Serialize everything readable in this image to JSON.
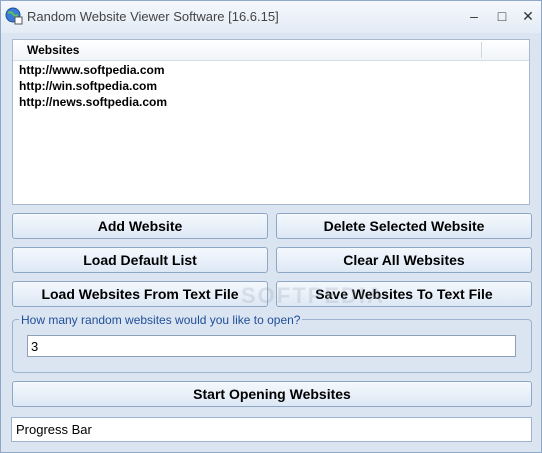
{
  "window": {
    "title": "Random Website Viewer Software [16.6.15]",
    "icon": "globe-app-icon",
    "controls": {
      "minimize": "–",
      "maximize": "□",
      "close": "✕"
    }
  },
  "list": {
    "column_header": "Websites",
    "rows": [
      "http://www.softpedia.com",
      "http://win.softpedia.com",
      "http://news.softpedia.com"
    ]
  },
  "buttons": {
    "add": "Add Website",
    "delete": "Delete Selected Website",
    "load_default": "Load Default List",
    "clear_all": "Clear All Websites",
    "load_from_file": "Load Websites From Text File",
    "save_to_file": "Save Websites To Text File",
    "start": "Start Opening Websites"
  },
  "count_group": {
    "label": "How many random websites would you like to open?",
    "value": "3"
  },
  "progress": {
    "label": "Progress Bar",
    "fraction": 0
  },
  "watermark": "SOFTPEDIA",
  "colors": {
    "background": "#dbe5f1",
    "group_label": "#1f4e9a"
  }
}
